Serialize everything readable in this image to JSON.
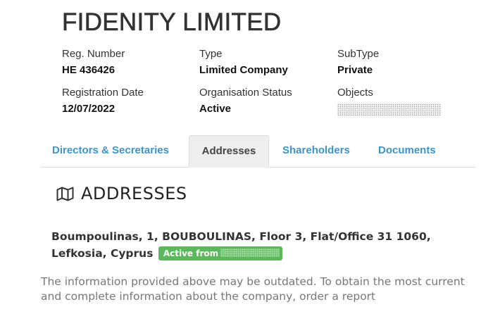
{
  "company": {
    "name": "FIDENITY LIMITED"
  },
  "fields": {
    "reg_number": {
      "label": "Reg. Number",
      "value": "HE 436426"
    },
    "type": {
      "label": "Type",
      "value": "Limited Company"
    },
    "subtype": {
      "label": "SubType",
      "value": "Private"
    },
    "registration_date": {
      "label": "Registration Date",
      "value": "12/07/2022"
    },
    "organisation_status": {
      "label": "Organisation Status",
      "value": "Active"
    },
    "objects": {
      "label": "Objects",
      "value_redacted": true
    }
  },
  "tabs": [
    {
      "label": "Directors & Secretaries",
      "active": false
    },
    {
      "label": "Addresses",
      "active": true
    },
    {
      "label": "Shareholders",
      "active": false
    },
    {
      "label": "Documents",
      "active": false
    }
  ],
  "section": {
    "icon": "map-icon",
    "heading": "ADDRESSES"
  },
  "address": {
    "line": "Boumpoulinas, 1, BOUBOULINAS, Floor 3, Flat/Office 31 1060, Lefkosia, Cyprus",
    "badge_label": "Active from",
    "badge_date_redacted": true
  },
  "disclaimer": "The information provided above may be outdated. To obtain the most current and complete information about the company, order a report",
  "colors": {
    "tab_link": "#3a95c9",
    "badge_green": "#5cb85c",
    "disclaimer_gray": "#777777"
  }
}
